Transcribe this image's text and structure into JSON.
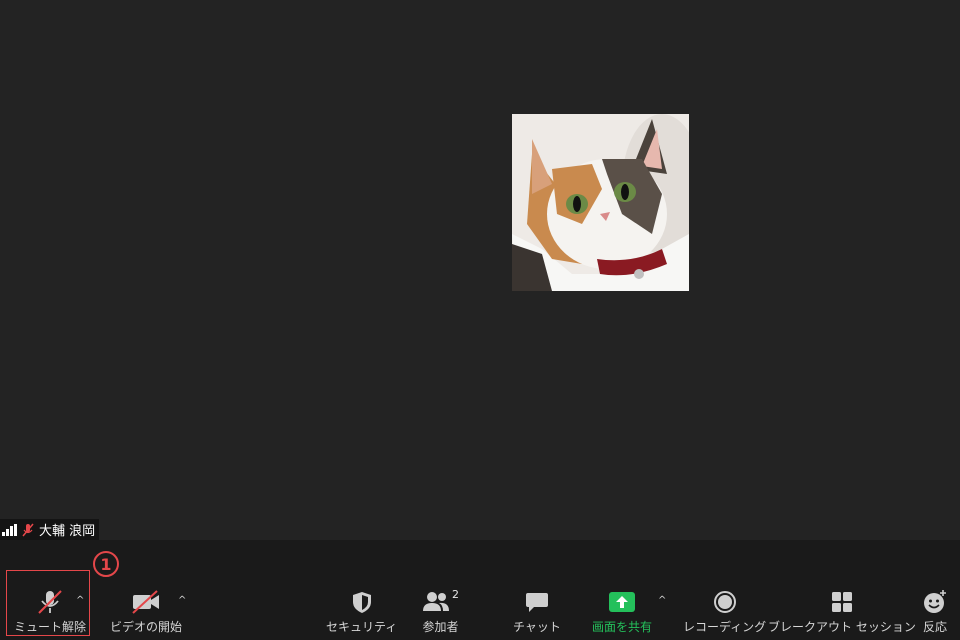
{
  "participant": {
    "name": "大輔 浪岡"
  },
  "callout": {
    "number": "1"
  },
  "toolbar": {
    "unmute_label": "ミュート解除",
    "start_video_label": "ビデオの開始",
    "security_label": "セキュリティ",
    "participants_label": "参加者",
    "participants_count": "2",
    "chat_label": "チャット",
    "share_screen_label": "画面を共有",
    "recording_label": "レコーディング",
    "breakout_label": "ブレークアウト セッション",
    "reactions_label": "反応"
  },
  "colors": {
    "background": "#232323",
    "toolbar": "#1a1a1a",
    "share_green": "#24c05b",
    "callout_red": "#e4474a",
    "muted_red": "#e4474a"
  },
  "icons": [
    "signal-icon",
    "mic-muted-icon",
    "video-off-icon",
    "shield-icon",
    "participants-icon",
    "chat-icon",
    "share-screen-icon",
    "record-icon",
    "breakout-grid-icon",
    "reaction-icon",
    "caret-up-icon"
  ]
}
